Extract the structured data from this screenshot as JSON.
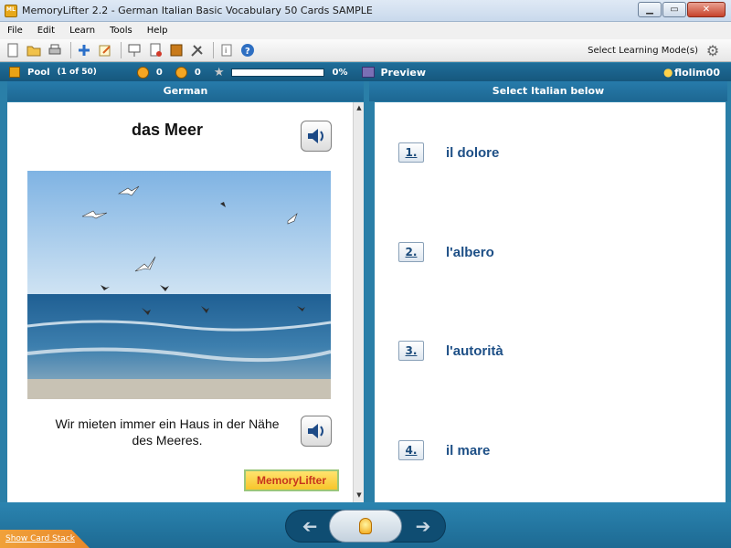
{
  "window": {
    "title": "MemoryLifter 2.2 - German Italian Basic Vocabulary 50 Cards SAMPLE"
  },
  "menu": [
    "File",
    "Edit",
    "Learn",
    "Tools",
    "Help"
  ],
  "toolbar": {
    "icons": [
      "new-document-icon",
      "open-folder-icon",
      "print-icon",
      "add-card-icon",
      "edit-card-icon",
      "presentation-icon",
      "print-cards-icon",
      "learning-box-icon",
      "tools-icon",
      "info-icon",
      "help-icon"
    ],
    "mode_label": "Select Learning Mode(s)"
  },
  "status": {
    "pool_label": "Pool",
    "pool_count": "(1 of 50)",
    "correct_count": "0",
    "wrong_count": "0",
    "progress_percent": 0,
    "progress_label": "0%",
    "preview_label": "Preview",
    "user": "flolim00"
  },
  "columns": {
    "left": "German",
    "right": "Select Italian below"
  },
  "card": {
    "word": "das Meer",
    "sentence": "Wir mieten immer ein Haus in der Nähe des Meeres.",
    "logo_text_1": "Memory",
    "logo_text_2": "Lifter"
  },
  "answers": [
    {
      "num": "1.",
      "label": "il dolore"
    },
    {
      "num": "2.",
      "label": "l'albero"
    },
    {
      "num": "3.",
      "label": "l'autorità"
    },
    {
      "num": "4.",
      "label": "il mare"
    }
  ],
  "footer": {
    "show_stack": "Show Card Stack"
  },
  "colors": {
    "status_bar": "#1f6d99",
    "answer_text": "#1d4f86",
    "accent": "#f0a13a"
  }
}
